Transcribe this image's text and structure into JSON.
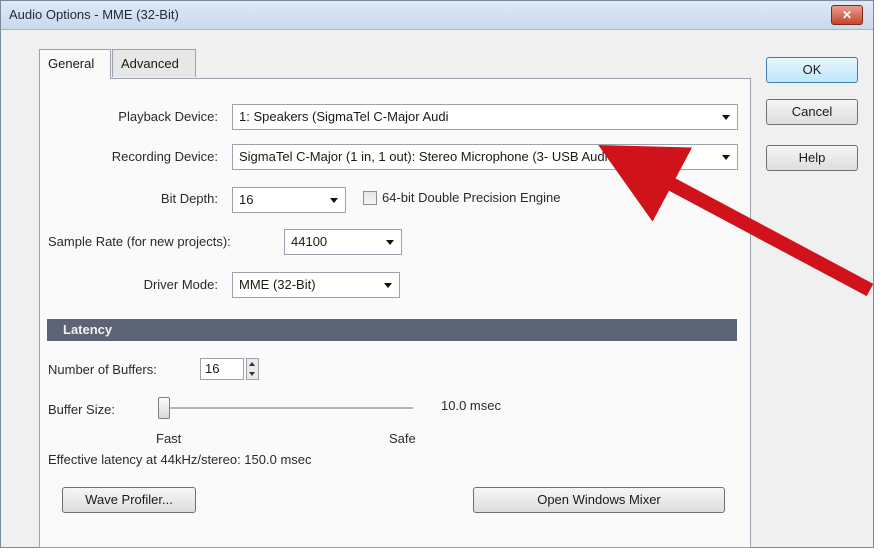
{
  "window": {
    "title": "Audio Options - MME (32-Bit)",
    "close_glyph": "✕"
  },
  "tabs": [
    {
      "label": "General",
      "active": true
    },
    {
      "label": "Advanced",
      "active": false
    }
  ],
  "general": {
    "playback_device": {
      "label": "Playback Device:",
      "value": "1: Speakers (SigmaTel C-Major Audi"
    },
    "recording_device": {
      "label": "Recording Device:",
      "value": "SigmaTel C-Major (1 in, 1 out): Stereo Microphone (3- USB Audio CC"
    },
    "bit_depth": {
      "label": "Bit Depth:",
      "value": "16"
    },
    "double_precision": {
      "label": "64-bit Double Precision Engine",
      "checked": false
    },
    "sample_rate": {
      "label": "Sample Rate (for new projects):",
      "value": "44100"
    },
    "driver_mode": {
      "label": "Driver Mode:",
      "value": "MME (32-Bit)"
    }
  },
  "latency": {
    "header": "Latency",
    "buffers_label": "Number of Buffers:",
    "buffers_value": "16",
    "buffer_size_label": "Buffer Size:",
    "buffer_size_value": "10.0 msec",
    "buffer_size_fraction": 0.0,
    "fast_label": "Fast",
    "safe_label": "Safe",
    "effective_latency": "Effective latency at 44kHz/stereo:  150.0 msec"
  },
  "buttons": {
    "ok": "OK",
    "cancel": "Cancel",
    "help": "Help",
    "wave_profiler": "Wave Profiler...",
    "open_mixer": "Open Windows Mixer"
  },
  "annotation": {
    "color": "#d0131b"
  },
  "colors": {
    "section_bar": "#5a6473",
    "default_button": "#bee6fd"
  }
}
